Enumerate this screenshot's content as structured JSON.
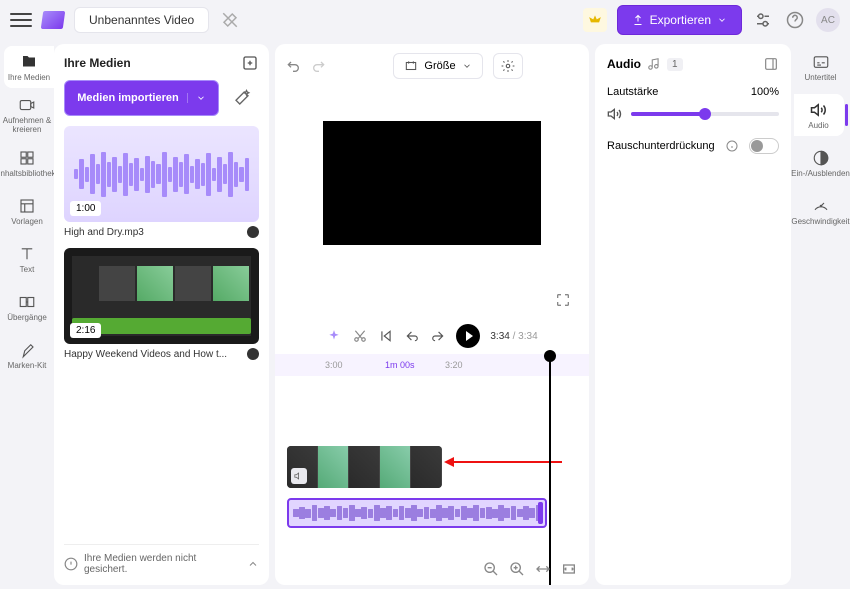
{
  "header": {
    "title": "Unbenanntes Video",
    "export_label": "Exportieren",
    "avatar_initials": "AC"
  },
  "left_rail": [
    {
      "id": "media",
      "label": "Ihre Medien"
    },
    {
      "id": "record",
      "label": "Aufnehmen & kreieren"
    },
    {
      "id": "library",
      "label": "Inhaltsbibliothek"
    },
    {
      "id": "templates",
      "label": "Vorlagen"
    },
    {
      "id": "text",
      "label": "Text"
    },
    {
      "id": "transitions",
      "label": "Übergänge"
    },
    {
      "id": "brand",
      "label": "Marken-Kit"
    }
  ],
  "media_panel": {
    "title": "Ihre Medien",
    "import_label": "Medien importieren",
    "items": [
      {
        "name": "High and Dry.mp3",
        "duration": "1:00",
        "type": "audio"
      },
      {
        "name": "Happy Weekend Videos and How t...",
        "duration": "2:16",
        "type": "video"
      }
    ],
    "footer_msg": "Ihre Medien werden nicht gesichert."
  },
  "canvas": {
    "size_label": "Größe",
    "current_time": "3:34",
    "total_time": "3:34",
    "ruler": {
      "t1": "3:00",
      "cur": "1m 00s",
      "t2": "3:20"
    }
  },
  "props": {
    "title": "Audio",
    "badge": "1",
    "volume_label": "Lautstärke",
    "volume_value": "100%",
    "noise_label": "Rauschunterdrückung"
  },
  "right_rail": [
    {
      "id": "subtitles",
      "label": "Untertitel"
    },
    {
      "id": "audio",
      "label": "Audio"
    },
    {
      "id": "fade",
      "label": "Ein-/Ausblenden"
    },
    {
      "id": "speed",
      "label": "Geschwindigkeit"
    }
  ]
}
